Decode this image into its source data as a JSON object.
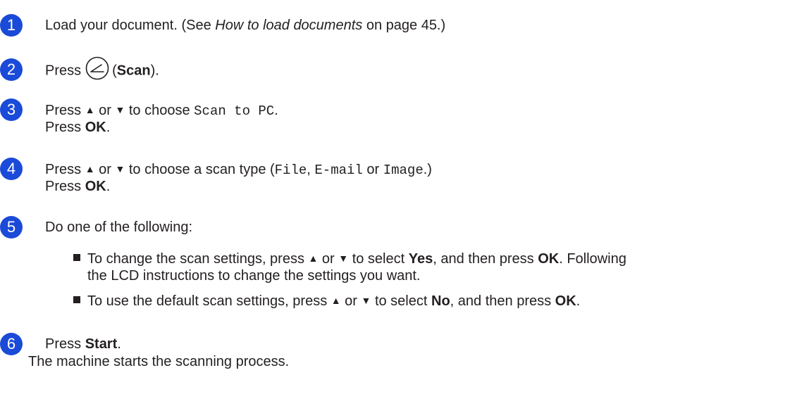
{
  "step_numbers": [
    "1",
    "2",
    "3",
    "4",
    "5",
    "6"
  ],
  "step1": {
    "pre": "Load your document. (See ",
    "link": "How to load documents",
    "post": " on page 45.)"
  },
  "step2": {
    "press": "Press",
    "open": "(",
    "bold": "Scan",
    "close": ")."
  },
  "arrows": {
    "up": "▲",
    "down": "▼"
  },
  "step3": {
    "press": "Press ",
    "or": " or ",
    "to_choose": " to choose ",
    "option": "Scan to PC",
    "dot": ".",
    "line2_pre": "Press ",
    "ok": "OK",
    "line2_post": "."
  },
  "step4": {
    "press": "Press ",
    "or": " or ",
    "to_choose": " to choose a scan type (",
    "opt1": "File",
    "comma": ", ",
    "opt2": "E-mail",
    "or2": " or ",
    "opt3": "Image",
    "end": ".)",
    "line2_pre": "Press ",
    "ok": "OK",
    "line2_post": "."
  },
  "step5": {
    "intro": "Do one of the following:",
    "bullet1_pre": "To change the scan settings, press ",
    "or": " or ",
    "bullet1_mid": " to select ",
    "yes": "Yes",
    "bullet1_post": ", and then press ",
    "ok": "OK",
    "bullet1_end": ". Following",
    "bullet1_line2": "the LCD instructions to change the settings you want.",
    "bullet2_pre": "To use the default scan settings, press ",
    "bullet2_mid": " to select ",
    "no": "No",
    "bullet2_post": ", and then press ",
    "bullet2_end": "."
  },
  "step6": {
    "press": "Press ",
    "start": "Start",
    "dot": ".",
    "line2": "The machine starts the scanning process."
  },
  "colors": {
    "badge": "#1a4ad8",
    "text": "#231f20"
  },
  "icons": {
    "scan_button": "scan-button-icon",
    "bullet": "square-bullet-icon"
  }
}
